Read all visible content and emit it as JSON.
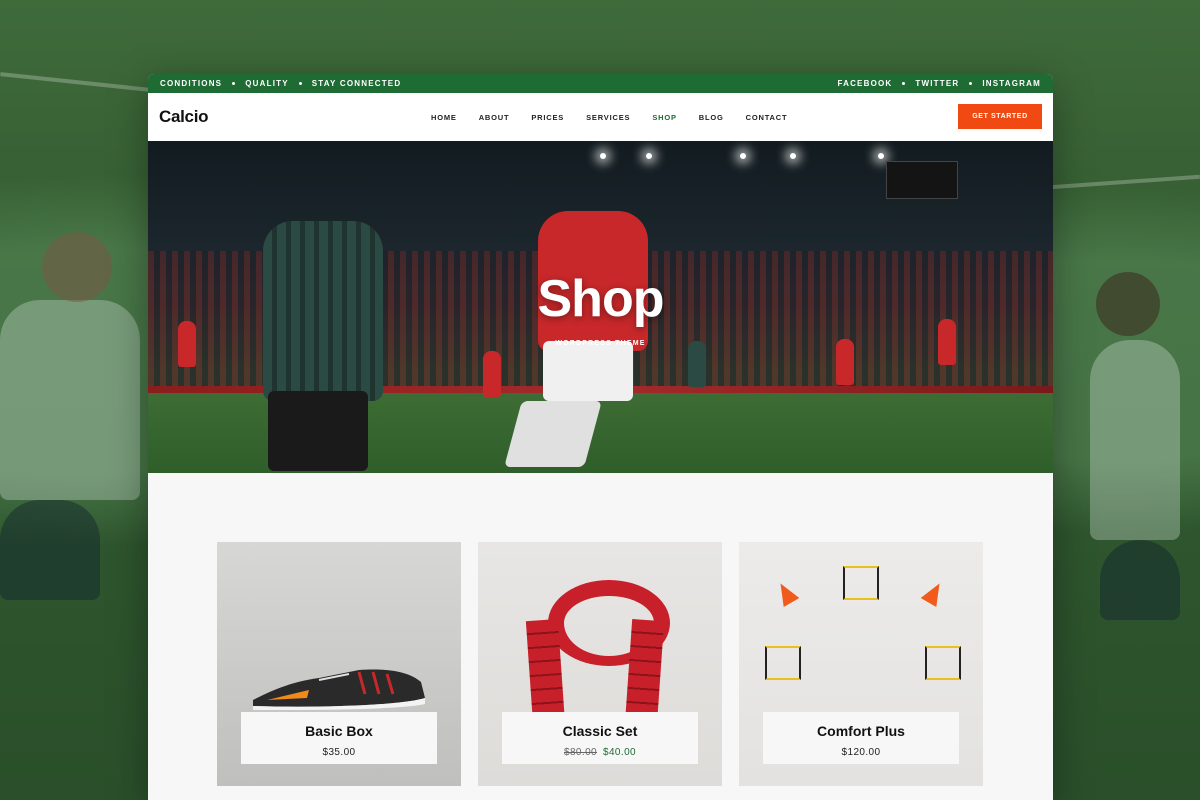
{
  "topbar": {
    "left": [
      "CONDITIONS",
      "QUALITY",
      "STAY CONNECTED"
    ],
    "right": [
      "FACEBOOK",
      "TWITTER",
      "INSTAGRAM"
    ]
  },
  "brand": "Calcio",
  "nav": [
    "HOME",
    "ABOUT",
    "PRICES",
    "SERVICES",
    "SHOP",
    "BLOG",
    "CONTACT"
  ],
  "nav_active": "SHOP",
  "cta": "GET STARTED",
  "hero": {
    "title": "Shop",
    "subtitle": "WORDPRESS THEME"
  },
  "products": [
    {
      "name": "Basic Box",
      "price": "$35.00",
      "old_price": ""
    },
    {
      "name": "Classic Set",
      "price": "$40.00",
      "old_price": "$80.00"
    },
    {
      "name": "Comfort Plus",
      "price": "$120.00",
      "old_price": ""
    }
  ],
  "colors": {
    "accent_green": "#1f6b34",
    "cta_orange": "#f04a12"
  }
}
